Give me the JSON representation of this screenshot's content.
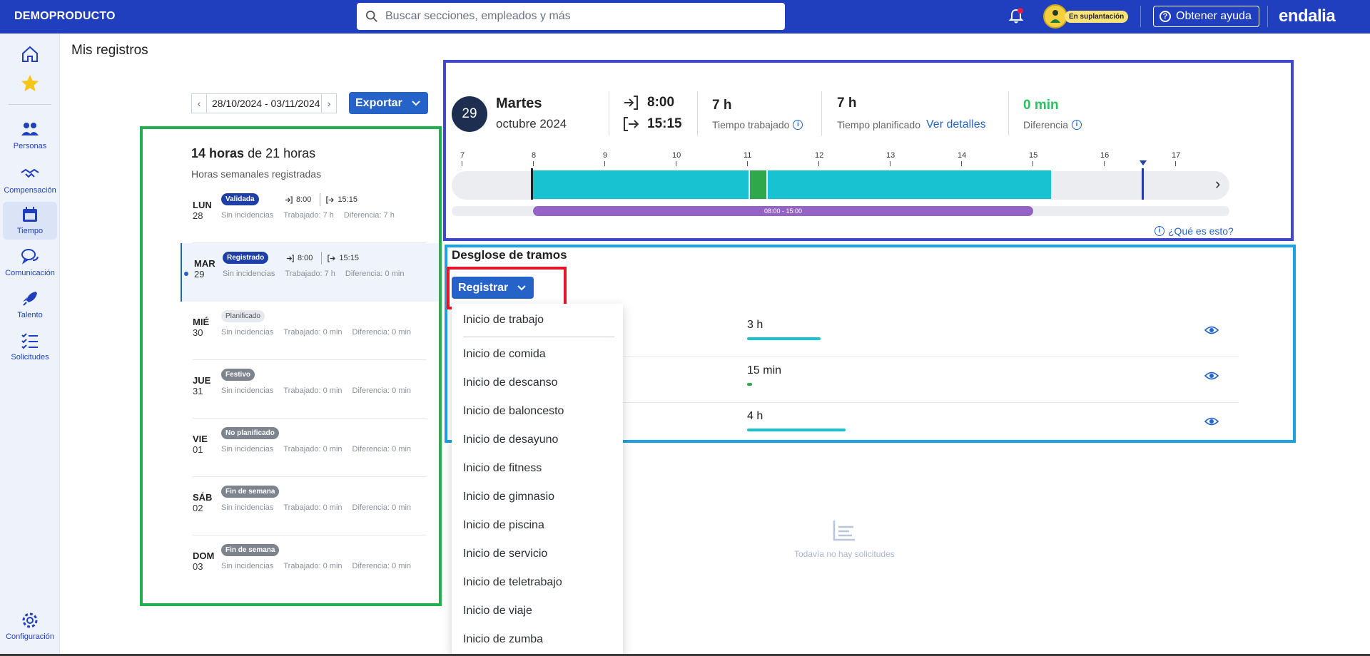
{
  "topbar": {
    "brand": "DEMOPRODUCTO",
    "search_placeholder": "Buscar secciones, empleados y más",
    "impersonation_badge": "En suplantación",
    "help_label": "Obtener ayuda",
    "logo_text": "endalia"
  },
  "sidebar": {
    "items": [
      {
        "label": "",
        "icon": "home-icon"
      },
      {
        "label": "",
        "icon": "star-icon"
      },
      {
        "label": "Personas",
        "icon": "people-icon"
      },
      {
        "label": "Compensación",
        "icon": "handshake-icon"
      },
      {
        "label": "Tiempo",
        "icon": "calendar-icon",
        "active": true
      },
      {
        "label": "Comunicación",
        "icon": "chat-icon"
      },
      {
        "label": "Talento",
        "icon": "rocket-icon"
      },
      {
        "label": "Solicitudes",
        "icon": "checklist-icon"
      },
      {
        "label": "Configuración",
        "icon": "gear-icon"
      }
    ]
  },
  "page": {
    "title": "Mis registros",
    "date_range": "28/10/2024 - 03/11/2024",
    "export_label": "Exportar"
  },
  "week": {
    "hours_done": "14 horas",
    "hours_of": "de 21 horas",
    "subtitle": "Horas semanales registradas",
    "days": [
      {
        "name": "LUN",
        "num": "28",
        "status": "Validada",
        "in": "8:00",
        "out": "15:15",
        "incid": "Sin incidencias",
        "worked": "Trabajado: 7 h",
        "diff": "Diferencia: 7 h"
      },
      {
        "name": "MAR",
        "num": "29",
        "status": "Registrado",
        "in": "8:00",
        "out": "15:15",
        "incid": "Sin incidencias",
        "worked": "Trabajado: 7 h",
        "diff": "Diferencia: 0 min"
      },
      {
        "name": "MIÉ",
        "num": "30",
        "status": "Planificado",
        "incid": "Sin incidencias",
        "worked": "Trabajado: 0 min",
        "diff": "Diferencia: 0 min"
      },
      {
        "name": "JUE",
        "num": "31",
        "status": "Festivo",
        "incid": "Sin incidencias",
        "worked": "Trabajado: 0 min",
        "diff": "Diferencia: 0 min"
      },
      {
        "name": "VIE",
        "num": "01",
        "status": "No planificado",
        "incid": "Sin incidencias",
        "worked": "Trabajado: 0 min",
        "diff": "Diferencia: 0 min"
      },
      {
        "name": "SÁB",
        "num": "02",
        "status": "Fin de semana",
        "incid": "Sin incidencias",
        "worked": "Trabajado: 0 min",
        "diff": "Diferencia: 0 min"
      },
      {
        "name": "DOM",
        "num": "03",
        "status": "Fin de semana",
        "incid": "Sin incidencias",
        "worked": "Trabajado: 0 min",
        "diff": "Diferencia: 0 min"
      }
    ]
  },
  "day": {
    "number": "29",
    "weekday": "Martes",
    "month_year": "octubre 2024",
    "clock_in": "8:00",
    "clock_out": "15:15",
    "worked_value": "7 h",
    "worked_label": "Tiempo trabajado",
    "planned_value": "7 h",
    "planned_label": "Tiempo planificado",
    "details_link": "Ver detalles",
    "diff_value": "0 min",
    "diff_label": "Diferencia",
    "timeline_hours": [
      "7",
      "8",
      "9",
      "10",
      "11",
      "12",
      "13",
      "14",
      "15",
      "16",
      "17"
    ],
    "planned_range": "08:00 - 15:00",
    "what_is": "¿Qué es esto?"
  },
  "desglose": {
    "title": "Desglose de tramos",
    "register_label": "Registrar",
    "rows": [
      {
        "value": "3 h",
        "color": "#19c2d0"
      },
      {
        "value": "15 min",
        "color": "#2ea84a"
      },
      {
        "value": "4 h",
        "color": "#19c2d0"
      }
    ],
    "empty_text": "Todavía no hay solicitudes"
  },
  "menu": {
    "items": [
      "Inicio de trabajo",
      "Inicio de comida",
      "Inicio de descanso",
      "Inicio de baloncesto",
      "Inicio de desayuno",
      "Inicio de fitness",
      "Inicio de gimnasio",
      "Inicio de piscina",
      "Inicio de servicio",
      "Inicio de teletrabajo",
      "Inicio de viaje",
      "Inicio de zumba"
    ]
  },
  "colors": {
    "primary": "#1f3fbf",
    "button": "#2563c9",
    "work": "#19c2d0",
    "break": "#2ea84a",
    "planned": "#9562c6",
    "positive": "#22c55e"
  }
}
